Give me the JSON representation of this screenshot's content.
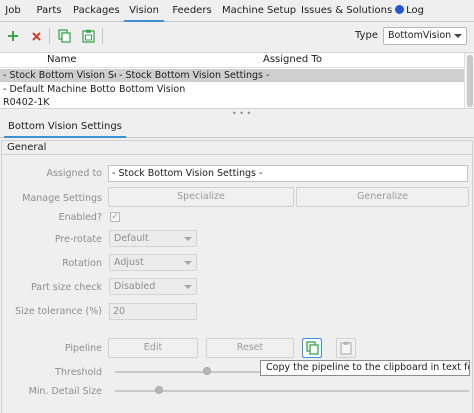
{
  "tabs": [
    {
      "label": "Job"
    },
    {
      "label": "Parts"
    },
    {
      "label": "Packages"
    },
    {
      "label": "Vision"
    },
    {
      "label": "Feeders"
    },
    {
      "label": "Machine Setup"
    },
    {
      "label": "Issues & Solutions"
    },
    {
      "label": "Log"
    }
  ],
  "active_tab": "Vision",
  "toolbar": {
    "icons": [
      "add-icon",
      "delete-icon",
      "copy-icon",
      "paste-icon"
    ],
    "type_label": "Type",
    "type_value": "BottomVision"
  },
  "table": {
    "columns": [
      "Name",
      "Assigned To"
    ],
    "rows": [
      {
        "name": "- Stock Bottom Vision Set...",
        "assigned": "- Stock Bottom Vision Settings -",
        "selected": true
      },
      {
        "name": "- Default Machine Botto...",
        "assigned": "Bottom Vision",
        "selected": false
      },
      {
        "name": "R0402-1K",
        "assigned": "",
        "selected": false
      }
    ]
  },
  "subtab": "Bottom Vision Settings",
  "general": {
    "title": "General",
    "assigned_to_label": "Assigned to",
    "assigned_to_value": "- Stock Bottom Vision Settings -",
    "manage_settings_label": "Manage Settings",
    "specialize_label": "Specialize",
    "generalize_label": "Generalize",
    "enabled_label": "Enabled?",
    "enabled_checked": true,
    "prerotate_label": "Pre-rotate",
    "prerotate_value": "Default",
    "rotation_label": "Rotation",
    "rotation_value": "Adjust",
    "part_size_check_label": "Part size check",
    "part_size_check_value": "Disabled",
    "size_tolerance_label": "Size tolerance (%)",
    "size_tolerance_value": "20",
    "pipeline_label": "Pipeline",
    "edit_label": "Edit",
    "reset_label": "Reset",
    "threshold_label": "Threshold",
    "min_detail_size_label": "Min. Detail Size"
  },
  "tooltip": "Copy the pipeline to the clipboard in text format.",
  "colors": {
    "accent": "#3d8fd6",
    "issues_dot": "#2457d4",
    "add_icon": "#3aa64c",
    "delete_icon": "#d23c2e",
    "copy_icon": "#3aa64c"
  }
}
